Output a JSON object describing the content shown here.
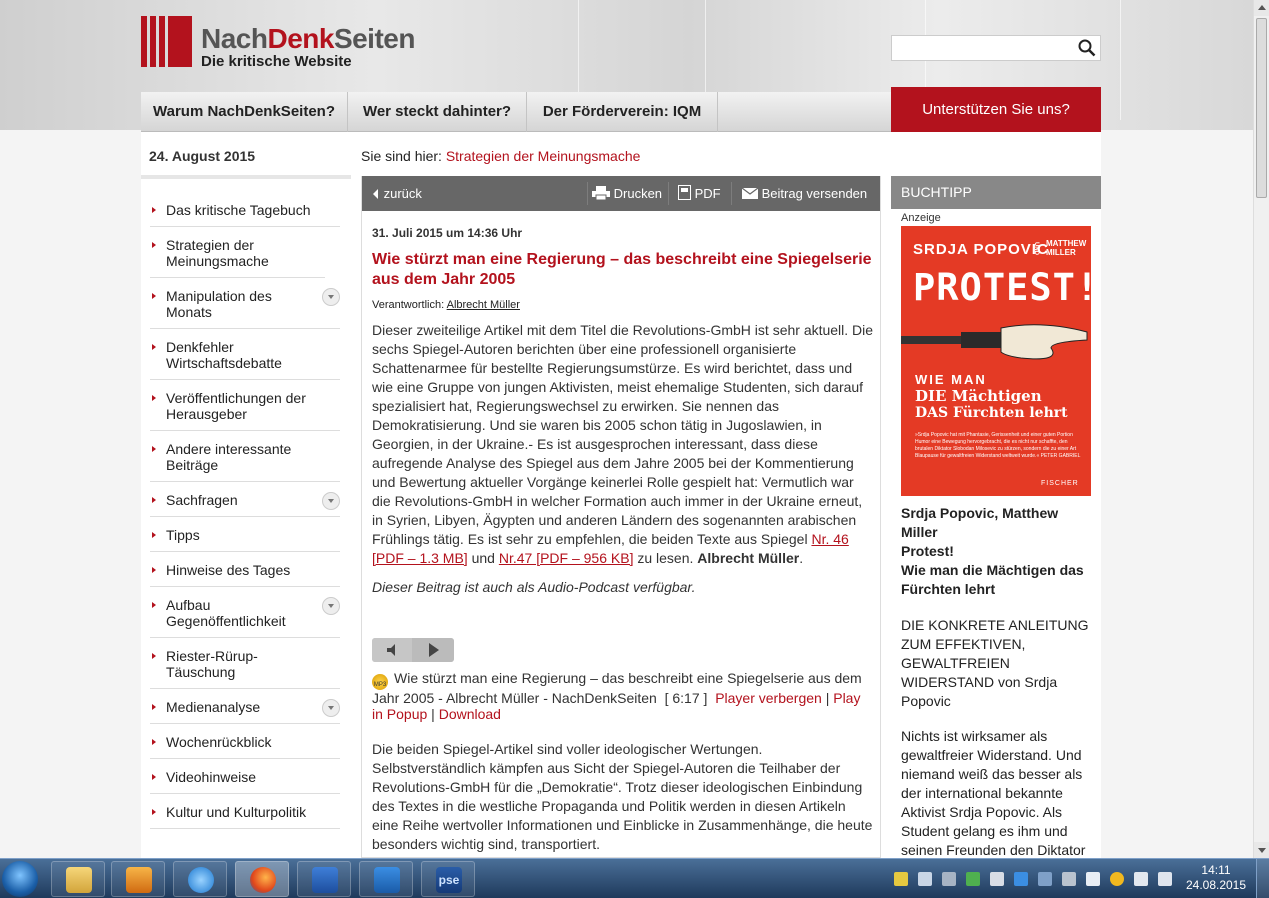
{
  "site": {
    "logo_name_a": "Nach",
    "logo_name_b": "Denk",
    "logo_name_c": "Seiten",
    "logo_tagline": "Die kritische Website",
    "search_placeholder": ""
  },
  "nav": {
    "items": [
      "Warum NachDenkSeiten?",
      "Wer steckt dahinter?",
      "Der Förderverein: IQM"
    ],
    "support": "Unterstützen Sie uns?"
  },
  "date": "24. August 2015",
  "breadcrumb": {
    "prefix": "Sie sind hier:",
    "current": "Strategien der Meinungsmache"
  },
  "sidebar": {
    "items": [
      {
        "label": "Das kritische Tagebuch"
      },
      {
        "label": "Strategien der Meinungsmache"
      },
      {
        "label": "Manipulation des Monats"
      },
      {
        "label": "Denkfehler Wirtschaftsdebatte"
      },
      {
        "label": "Veröffentlichungen der Herausgeber"
      },
      {
        "label": "Andere interessante Beiträge"
      },
      {
        "label": "Sachfragen"
      },
      {
        "label": "Tipps"
      },
      {
        "label": "Hinweise des Tages"
      },
      {
        "label": "Aufbau Gegenöffentlichkeit"
      },
      {
        "label": "Riester-Rürup-Täuschung"
      },
      {
        "label": "Medienanalyse"
      },
      {
        "label": "Wochenrückblick"
      },
      {
        "label": "Videohinweise"
      },
      {
        "label": "Kultur und Kulturpolitik"
      }
    ]
  },
  "toolbar": {
    "back": "zurück",
    "print": "Drucken",
    "pdf": "PDF",
    "send": "Beitrag versenden"
  },
  "article": {
    "date": "31. Juli 2015 um 14:36 Uhr",
    "title": "Wie stürzt man eine Regierung – das beschreibt eine Spiegelserie aus dem Jahr 2005",
    "resp_label": "Verantwortlich:",
    "resp_author": "Albrecht Müller",
    "p1_text": "Dieser zweiteilige Artikel mit dem Titel die Revolutions-GmbH ist sehr aktuell. Die sechs Spiegel-Autoren berichten über eine professionell organisierte Schattenarmee für bestellte Regierungsumstürze. Es wird berichtet, dass und wie eine Gruppe von jungen Aktivisten, meist ehemalige Studenten, sich darauf spezialisiert hat, Regierungswechsel zu erwirken. Sie nennen das Demokratisierung. Und sie waren bis 2005 schon tätig in Jugoslawien, in Georgien, in der Ukraine.- Es ist ausgesprochen interessant, dass diese aufregende Analyse des Spiegel aus dem Jahre 2005 bei der Kommentierung und Bewertung aktueller Vorgänge keinerlei Rolle gespielt hat: Vermutlich war die Revolutions-GmbH in welcher Formation auch immer in der Ukraine erneut, in Syrien, Libyen, Ägypten und anderen Ländern des sogenannten arabischen Frühlings tätig. Es ist sehr zu empfehlen, die beiden Texte aus Spiegel ",
    "link1": "Nr. 46 [PDF – 1.3 MB]",
    "and": " und ",
    "link2": "Nr.47 [PDF – 956 KB]",
    "p1_end": " zu lesen. ",
    "signature": "Albrecht Müller",
    "period": ".",
    "podcast_note": "Dieser Beitrag ist auch als Audio-Podcast verfügbar.",
    "pod_title": "Wie stürzt man eine Regierung – das beschreibt eine Spiegelserie aus dem Jahr 2005 - Albrecht Müller - NachDenkSeiten",
    "pod_duration": "[ 6:17 ]",
    "pod_hide": "Player verbergen",
    "pod_sep": "|",
    "pod_popup": "Play in Popup",
    "pod_download": "Download",
    "mp3_label": "MP3",
    "p2": "Die beiden Spiegel-Artikel sind voller ideologischer Wertungen. Selbstverständlich kämpfen aus Sicht der Spiegel-Autoren die Teilhaber der Revolutions-GmbH für die „Demokratie“. Trotz dieser ideologischen Einbindung des Textes in die westliche Propaganda und Politik werden in diesen Artikeln eine Reihe wertvoller Informationen und Einblicke in Zusammenhänge, die heute besonders wichtig sind, transportiert."
  },
  "booktip": {
    "heading": "BUCHTIPP",
    "ad": "Anzeige",
    "cover_author": "SRDJA POPOVIC",
    "cover_und": "UND",
    "cover_coauthor": "MATTHEW MILLER",
    "cover_title": "PROTEST!",
    "cover_sub1": "WIE MAN",
    "cover_sub2": "DIE Mächtigen",
    "cover_sub3": "DAS Fürchten lehrt",
    "cover_blurb": "»Srdja Popovic hat mit Phantasie, Gerissenheit und einer guten Portion Humor eine Bewegung hervorgebracht, die es nicht nur schaffte, den brutalen Diktator Slobodan Milosevic zu stürzen, sondern die zu einer Art Blaupause für gewaltfreien Widerstand weltweit wurde.« PETER GABRIEL",
    "cover_publisher": "FISCHER",
    "title_lines": [
      "Srdja Popovic, Matthew Miller",
      "Protest!",
      "Wie man die Mächtigen das Fürchten lehrt"
    ],
    "desc": "DIE KONKRETE ANLEITUNG ZUM EFFEKTIVEN, GEWALTFREIEN WIDERSTAND von Srdja Popovic",
    "desc2": "Nichts ist wirksamer als gewaltfreier Widerstand. Und niemand weiß das besser als der international bekannte Aktivist Srdja Popovic. Als Student gelang es ihm und seinen Freunden den Diktator"
  },
  "taskbar": {
    "time": "14:11",
    "date": "24.08.2015",
    "pse_label": "pse",
    "apps": [
      "explorer-icon",
      "media-player-icon",
      "internet-explorer-icon",
      "firefox-icon",
      "word-icon",
      "outlook-icon",
      "pse-icon"
    ]
  },
  "colors": {
    "brand_red": "#b3121d",
    "toolbar_grey": "#676767",
    "booktip_grey": "#888888",
    "cover_red": "#e43a25"
  }
}
